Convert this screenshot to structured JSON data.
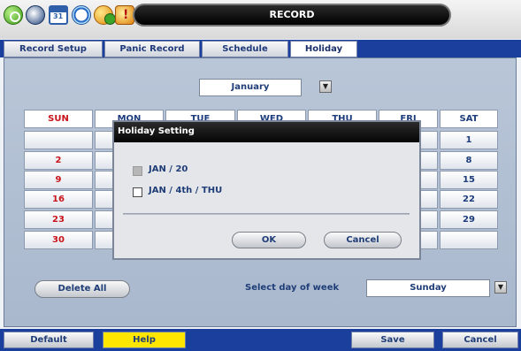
{
  "window": {
    "title": "RECORD"
  },
  "toolbar_icons": [
    "power-icon",
    "disk-icon",
    "calendar-icon",
    "clock-icon",
    "gear-icon",
    "alarm-icon"
  ],
  "tabs": [
    {
      "label": "Record Setup",
      "active": false
    },
    {
      "label": "Panic Record",
      "active": false
    },
    {
      "label": "Schedule",
      "active": false
    },
    {
      "label": "Holiday",
      "active": true
    }
  ],
  "month_select": {
    "value": "January"
  },
  "calendar": {
    "headers": [
      "SUN",
      "MON",
      "TUE",
      "WED",
      "THU",
      "FRI",
      "SAT"
    ],
    "rows": [
      [
        "",
        "",
        "",
        "",
        "",
        "",
        "1"
      ],
      [
        "2",
        "",
        "",
        "",
        "",
        "",
        "8"
      ],
      [
        "9",
        "",
        "",
        "",
        "",
        "",
        "15"
      ],
      [
        "16",
        "",
        "",
        "",
        "",
        "",
        "22"
      ],
      [
        "23",
        "",
        "",
        "",
        "",
        "",
        "29"
      ],
      [
        "30",
        "",
        "",
        "",
        "",
        "",
        ""
      ]
    ],
    "visible_header_fragments": [
      "MON",
      "TUE",
      "WED",
      "THU",
      "FRI"
    ]
  },
  "dialog": {
    "title": "Holiday Setting",
    "items": [
      {
        "label": "JAN / 20",
        "checked": false,
        "disabled": true
      },
      {
        "label": "JAN / 4th / THU",
        "checked": false,
        "disabled": false
      }
    ],
    "ok_label": "OK",
    "cancel_label": "Cancel"
  },
  "delete_all_label": "Delete All",
  "day_of_week": {
    "label": "Select day of week",
    "value": "Sunday"
  },
  "bottom": {
    "default_label": "Default",
    "help_label": "Help",
    "save_label": "Save",
    "cancel_label": "Cancel"
  },
  "colors": {
    "accent": "#1a3f9c",
    "sunday": "#c8141a",
    "help": "#ffe600"
  }
}
